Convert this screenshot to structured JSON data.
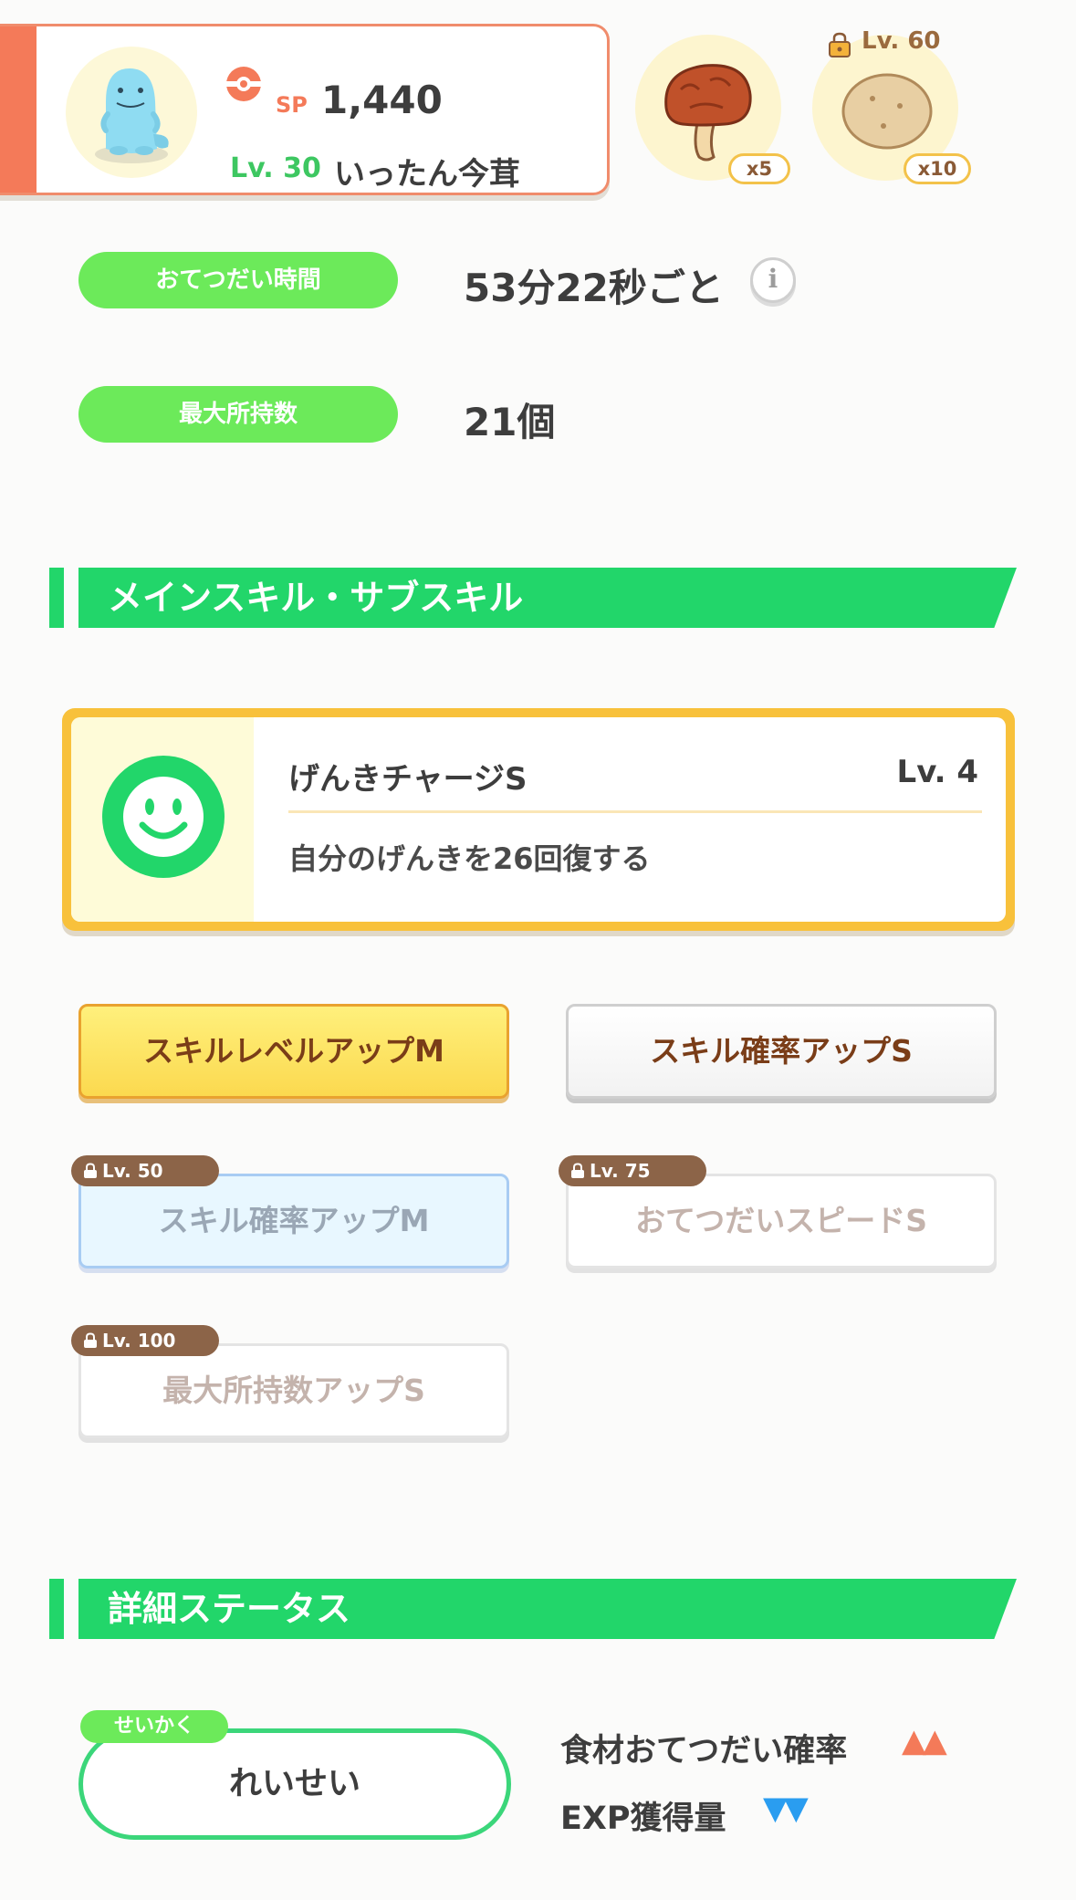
{
  "pokemon": {
    "sp_label": "SP",
    "sp_value": "1,440",
    "level": "Lv. 30",
    "nickname": "いったん今茸"
  },
  "ingredients": [
    {
      "icon": "mushroom-icon",
      "qty": "x5"
    },
    {
      "icon": "potato-icon",
      "qty": "x10",
      "unlock_level": "Lv. 60"
    }
  ],
  "stats": {
    "help_time_label": "おてつだい時間",
    "help_time_value": "53分22秒ごと",
    "max_carry_label": "最大所持数",
    "max_carry_value": "21個"
  },
  "sections": {
    "skills": "メインスキル・サブスキル",
    "details": "詳細ステータス"
  },
  "main_skill": {
    "name": "げんきチャージS",
    "level": "Lv. 4",
    "description": "自分のげんきを26回復する"
  },
  "sub_skills": [
    {
      "label": "スキルレベルアップM"
    },
    {
      "label": "スキル確率アップS"
    },
    {
      "label": "スキル確率アップM",
      "lock": "Lv. 50"
    },
    {
      "label": "おてつだいスピードS",
      "lock": "Lv. 75"
    },
    {
      "label": "最大所持数アップS",
      "lock": "Lv. 100"
    }
  ],
  "nature": {
    "tag": "せいかく",
    "name": "れいせい",
    "up_label": "食材おてつだい確率",
    "up_marks": "▲▲",
    "down_label": "EXP獲得量",
    "down_marks": "▼▼"
  },
  "colors": {
    "accent_green": "#22d66a",
    "pill_green": "#6cea5a",
    "header_orange": "#f47a59",
    "up_orange": "#f47a59",
    "down_blue": "#2a9df0"
  }
}
